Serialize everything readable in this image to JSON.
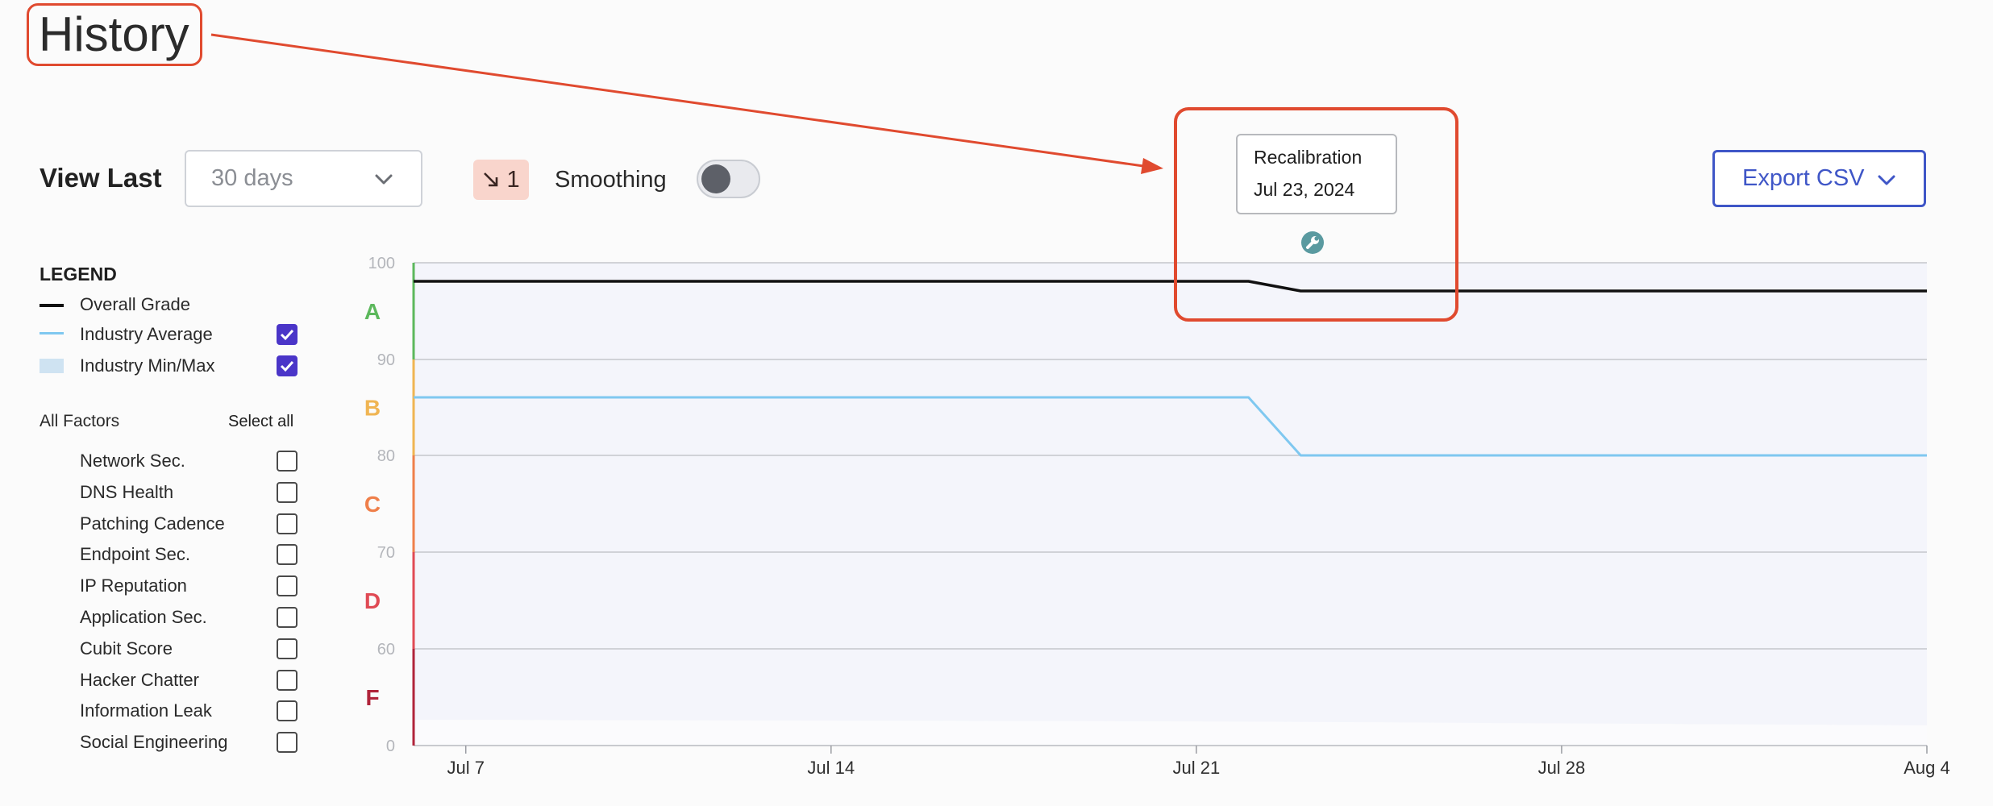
{
  "header": {
    "title": "History"
  },
  "controls": {
    "view_last_label": "View Last",
    "range_value": "30 days",
    "trend_badge": {
      "icon": "arrow-down-right-icon",
      "count": "1",
      "color": "#f9d5cc"
    },
    "smoothing_label": "Smoothing",
    "smoothing_on": false,
    "export_label": "Export CSV"
  },
  "legend": {
    "title": "LEGEND",
    "items": [
      {
        "label": "Overall Grade",
        "color": "#111111",
        "has_checkbox": false
      },
      {
        "label": "Industry Average",
        "color": "#7fc8f0",
        "has_checkbox": true,
        "checked": true
      },
      {
        "label": "Industry Min/Max",
        "color": "#cfe3f2",
        "has_checkbox": true,
        "checked": true
      }
    ]
  },
  "factors": {
    "all_label": "All Factors",
    "select_all_label": "Select all",
    "items": [
      {
        "label": "Network Sec.",
        "checked": false
      },
      {
        "label": "DNS Health",
        "checked": false
      },
      {
        "label": "Patching Cadence",
        "checked": false
      },
      {
        "label": "Endpoint Sec.",
        "checked": false
      },
      {
        "label": "IP Reputation",
        "checked": false
      },
      {
        "label": "Application Sec.",
        "checked": false
      },
      {
        "label": "Cubit Score",
        "checked": false
      },
      {
        "label": "Hacker Chatter",
        "checked": false
      },
      {
        "label": "Information Leak",
        "checked": false
      },
      {
        "label": "Social Engineering",
        "checked": false
      }
    ]
  },
  "event": {
    "title": "Recalibration",
    "date": "Jul 23, 2024",
    "icon": "wrench-icon",
    "color": "#5a9aa0"
  },
  "chart_data": {
    "type": "line",
    "x_ticks": [
      "Jul 7",
      "Jul 14",
      "Jul 21",
      "Jul 28",
      "Aug 4"
    ],
    "y_ticks": [
      0,
      60,
      70,
      80,
      90,
      100
    ],
    "grades": [
      {
        "label": "A",
        "color": "#5cb85c"
      },
      {
        "label": "B",
        "color": "#f0b552"
      },
      {
        "label": "C",
        "color": "#ef7f4a"
      },
      {
        "label": "D",
        "color": "#e04a54"
      },
      {
        "label": "F",
        "color": "#b0243a"
      }
    ],
    "x": [
      "Jul 6",
      "Jul 22",
      "Jul 23",
      "Aug 4"
    ],
    "series": [
      {
        "values": [
          98,
          98,
          97,
          97
        ],
        "color": "#111111"
      },
      {
        "values": [
          86,
          86,
          80,
          80
        ],
        "color": "#7fc8f0"
      }
    ]
  }
}
